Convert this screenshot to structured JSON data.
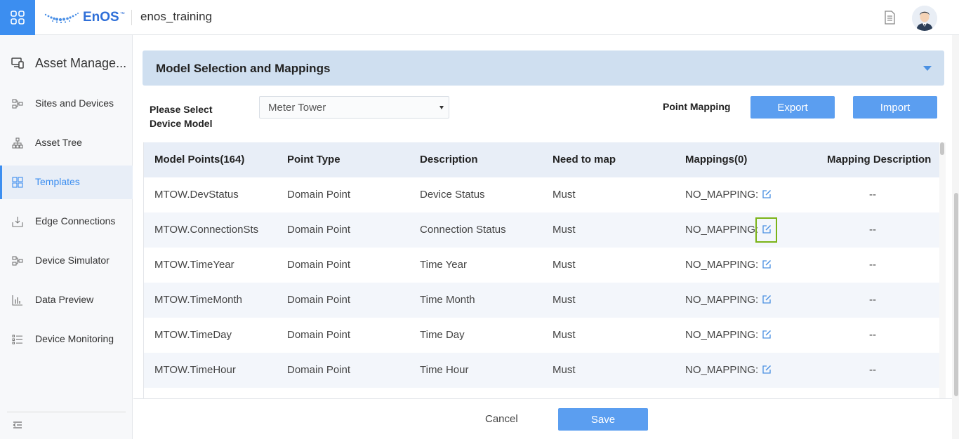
{
  "header": {
    "logo_text": "EnOS",
    "logo_tm": "™",
    "org_name": "enos_training"
  },
  "sidebar": {
    "title": "Asset Manage...",
    "items": [
      {
        "label": "Sites and Devices",
        "icon": "sites-icon"
      },
      {
        "label": "Asset Tree",
        "icon": "tree-icon"
      },
      {
        "label": "Templates",
        "icon": "templates-icon",
        "active": true
      },
      {
        "label": "Edge Connections",
        "icon": "edge-icon"
      },
      {
        "label": "Device Simulator",
        "icon": "simulator-icon"
      },
      {
        "label": "Data Preview",
        "icon": "chart-icon"
      },
      {
        "label": "Device Monitoring",
        "icon": "monitoring-icon"
      }
    ]
  },
  "panel": {
    "title": "Model Selection and Mappings"
  },
  "selector": {
    "label_line1": "Please Select",
    "label_line2": "Device Model",
    "value": "Meter Tower"
  },
  "mapping": {
    "label": "Point Mapping",
    "export_label": "Export",
    "import_label": "Import"
  },
  "table": {
    "headers": [
      "Model Points(164)",
      "Point Type",
      "Description",
      "Need to map",
      "Mappings(0)",
      "Mapping Description"
    ],
    "rows": [
      {
        "point": "MTOW.DevStatus",
        "type": "Domain Point",
        "desc": "Device Status",
        "need": "Must",
        "mapping": "NO_MAPPING:",
        "mapdesc": "--"
      },
      {
        "point": "MTOW.ConnectionSts",
        "type": "Domain Point",
        "desc": "Connection Status",
        "need": "Must",
        "mapping": "NO_MAPPING:",
        "mapdesc": "--"
      },
      {
        "point": "MTOW.TimeYear",
        "type": "Domain Point",
        "desc": "Time Year",
        "need": "Must",
        "mapping": "NO_MAPPING:",
        "mapdesc": "--"
      },
      {
        "point": "MTOW.TimeMonth",
        "type": "Domain Point",
        "desc": "Time Month",
        "need": "Must",
        "mapping": "NO_MAPPING:",
        "mapdesc": "--"
      },
      {
        "point": "MTOW.TimeDay",
        "type": "Domain Point",
        "desc": "Time Day",
        "need": "Must",
        "mapping": "NO_MAPPING:",
        "mapdesc": "--"
      },
      {
        "point": "MTOW.TimeHour",
        "type": "Domain Point",
        "desc": "Time Hour",
        "need": "Must",
        "mapping": "NO_MAPPING:",
        "mapdesc": "--"
      }
    ]
  },
  "footer": {
    "cancel_label": "Cancel",
    "save_label": "Save"
  },
  "colors": {
    "accent": "#3c8ef0",
    "button": "#5b9ef0",
    "highlight": "#7ab317"
  }
}
